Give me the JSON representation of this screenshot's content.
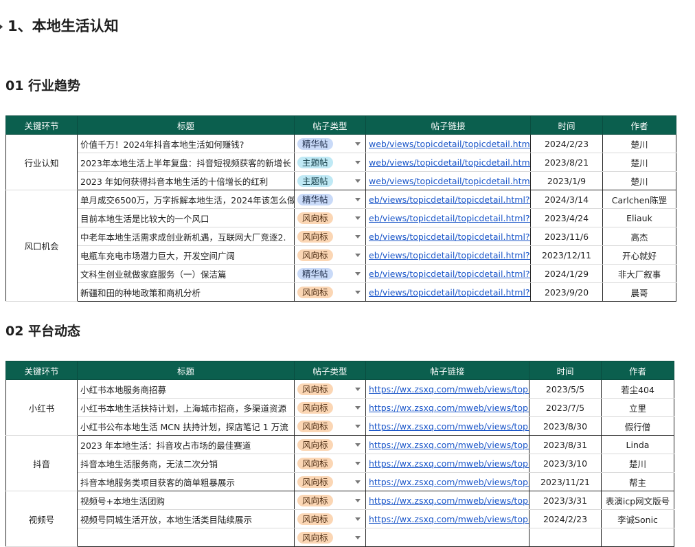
{
  "heading1": "1、本地生活认知",
  "section1": {
    "heading": "01 行业趋势",
    "columns": [
      "关键环节",
      "标题",
      "帖子类型",
      "帖子链接",
      "时间",
      "作者"
    ],
    "groups": [
      {
        "name": "行业认知",
        "rows": [
          {
            "title": "价值千万！2024年抖音本地生活如何赚钱?",
            "type": "精华帖",
            "type_class": "jh",
            "link": "web/views/topicdetail/topicdetail.html?topi",
            "date": "2024/2/23",
            "author": "楚川"
          },
          {
            "title": "2023年本地生活上半年复盘：抖音短视频获客的新增长",
            "type": "主题帖",
            "type_class": "zt",
            "link": "web/views/topicdetail/topicdetail.html?topi",
            "date": "2023/8/21",
            "author": "楚川"
          },
          {
            "title": "2023 年如何获得抖音本地生活的十倍增长的红利",
            "type": "主题帖",
            "type_class": "zt",
            "link": "web/views/topicdetail/topicdetail.html?topi",
            "date": "2023/1/9",
            "author": "楚川"
          }
        ]
      },
      {
        "name": "风口机会",
        "rows": [
          {
            "title": "单月成交6500万，万字拆解本地生活，2024年该怎么做",
            "type": "精华帖",
            "type_class": "jh",
            "link": "eb/views/topicdetail/topicdetail.html?topic",
            "date": "2024/3/14",
            "author": "Carlchen陈罡"
          },
          {
            "title": "目前本地生活是比较大的一个风口",
            "type": "风向标",
            "type_class": "fx",
            "link": "eb/views/topicdetail/topicdetail.html?topi",
            "date": "2023/4/24",
            "author": "Eliauk"
          },
          {
            "title": "中老年本地生活需求成创业新机遇，互联网大厂竞逐2.",
            "type": "风向标",
            "type_class": "fx",
            "link": "eb/views/topicdetail/topicdetail.html?topi",
            "date": "2023/11/6",
            "author": "高杰"
          },
          {
            "title": "电瓶车充电市场潜力巨大，开发空间广阔",
            "type": "风向标",
            "type_class": "fx",
            "link": "eb/views/topicdetail/topicdetail.html?topi",
            "date": "2023/12/11",
            "author": "开心就好"
          },
          {
            "title": "文科生创业就做家庭服务（一）保洁篇",
            "type": "精华帖",
            "type_class": "jh",
            "link": "eb/views/topicdetail/topicdetail.html?topi",
            "date": "2024/1/29",
            "author": "非大厂叙事"
          },
          {
            "title": "新疆和田的种地政策和商机分析",
            "type": "风向标",
            "type_class": "fx",
            "link": "eb/views/topicdetail/topicdetail.html?topi",
            "date": "2023/9/20",
            "author": "晨哥"
          }
        ]
      }
    ]
  },
  "section2": {
    "heading": "02 平台动态",
    "columns": [
      "关键环节",
      "标题",
      "帖子类型",
      "帖子链接",
      "时间",
      "作者"
    ],
    "groups": [
      {
        "name": "小红书",
        "rows": [
          {
            "title": "小红书本地服务商招募",
            "type": "风向标",
            "type_class": "fx",
            "link": "https://wx.zsxq.com/mweb/views/topicd",
            "date": "2023/5/5",
            "author": "若尘404"
          },
          {
            "title": "小红书本地生活扶持计划，上海城市招商，多渠道资源",
            "type": "风向标",
            "type_class": "fx",
            "link": "https://wx.zsxq.com/mweb/views/topicd",
            "date": "2023/7/5",
            "author": "立里"
          },
          {
            "title": "小红书公布本地生活 MCN 扶持计划，探店笔记 1 万流",
            "type": "风向标",
            "type_class": "fx",
            "link": "https://wx.zsxq.com/mweb/views/topicd",
            "date": "2023/8/30",
            "author": "假行僧"
          }
        ]
      },
      {
        "name": "抖音",
        "rows": [
          {
            "title": "2023 年本地生活：抖音攻占市场的最佳赛道",
            "type": "风向标",
            "type_class": "fx",
            "link": "https://wx.zsxq.com/mweb/views/topicd",
            "date": "2023/8/31",
            "author": "Linda"
          },
          {
            "title": "抖音本地生活服务商，无法二次分销",
            "type": "风向标",
            "type_class": "fx",
            "link": "https://wx.zsxq.com/mweb/views/topicd",
            "date": "2023/3/10",
            "author": "楚川"
          },
          {
            "title": "抖音本地服务类项目获客的简单粗暴展示",
            "type": "风向标",
            "type_class": "fx",
            "link": "https://wx.zsxq.com/mweb/views/topicd",
            "date": "2023/11/21",
            "author": "帮主"
          }
        ]
      },
      {
        "name": "视频号",
        "rows": [
          {
            "title": "视频号+本地生活团购",
            "type": "风向标",
            "type_class": "fx",
            "link": "https://wx.zsxq.com/mweb/views/topicd",
            "date": "2023/3/31",
            "author": "表演icp网文版号"
          },
          {
            "title": "视频号同城生活开放，本地生活类目陆续展示",
            "type": "风向标",
            "type_class": "fx",
            "link": "https://wx.zsxq.com/mweb/views/topicd",
            "date": "2024/2/23",
            "author": "李诚Sonic"
          },
          {
            "title": "",
            "type": "风向标",
            "type_class": "fx",
            "link": "",
            "date": "",
            "author": ""
          }
        ]
      }
    ]
  }
}
